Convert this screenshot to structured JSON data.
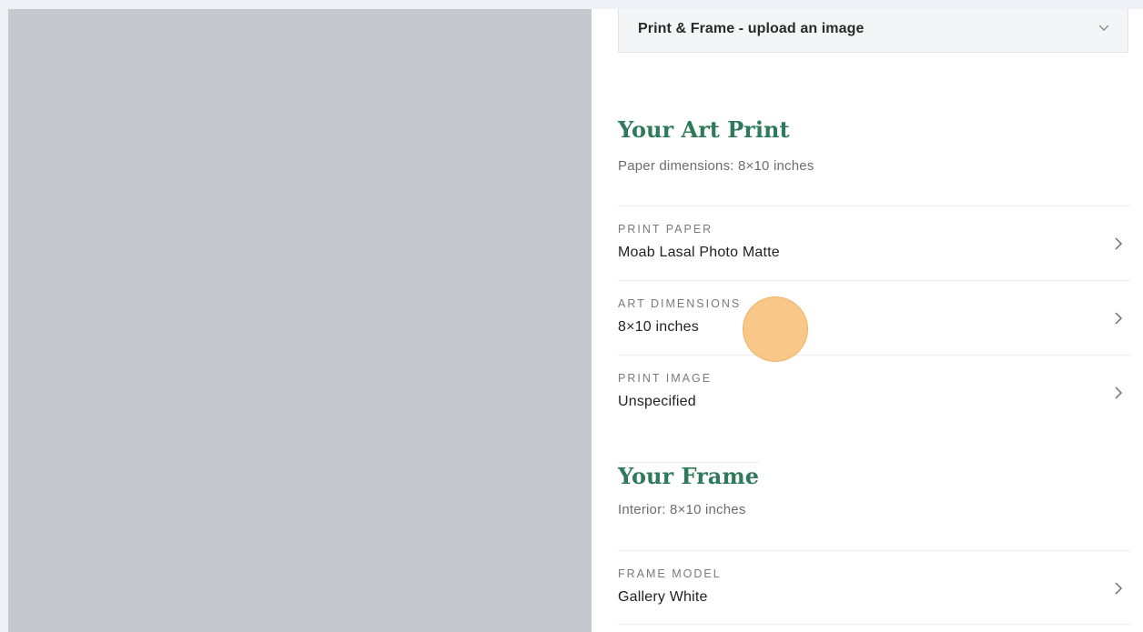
{
  "dropdown": {
    "label": "Print & Frame - upload an image",
    "icon": "chevron-down-icon"
  },
  "art_print": {
    "title": "Your Art Print",
    "subtitle": "Paper dimensions: 8×10 inches",
    "rows": [
      {
        "label": "PRINT PAPER",
        "value": "Moab Lasal Photo Matte"
      },
      {
        "label": "ART DIMENSIONS",
        "value": "8×10 inches"
      },
      {
        "label": "PRINT IMAGE",
        "value": "Unspecified"
      }
    ]
  },
  "frame": {
    "title": "Your Frame",
    "subtitle": "Interior: 8×10 inches",
    "rows": [
      {
        "label": "FRAME MODEL",
        "value": "Gallery White"
      }
    ]
  },
  "colors": {
    "accent_green": "#2e7a5a",
    "preview_gray": "#c5c8cc",
    "cursor_orange": "#f7b766"
  }
}
